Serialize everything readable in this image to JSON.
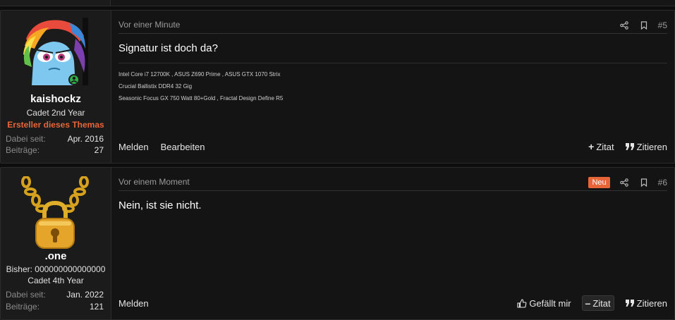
{
  "posts": [
    {
      "user": {
        "name": "kaishockz",
        "title": "Cadet 2nd Year",
        "banner": "Ersteller dieses Themas",
        "stats": [
          {
            "label": "Dabei seit:",
            "value": "Apr. 2016"
          },
          {
            "label": "Beiträge:",
            "value": "27"
          }
        ]
      },
      "date": "Vor einer Minute",
      "number": "#5",
      "body": "Signatur ist doch da?",
      "signature": [
        "Intel Core i7 12700K , ASUS Z690 Prime , ASUS GTX 1070 Strix",
        "Crucial Ballistix DDR4 32 Gig",
        "Seasonic Focus GX 750 Watt 80+Gold , Fractal Design Define R5"
      ],
      "actions_left": [
        "Melden",
        "Bearbeiten"
      ],
      "actions_right": {
        "quote": "Zitat",
        "cite": "Zitieren"
      }
    },
    {
      "user": {
        "name": ".one",
        "extra": "Bisher: 000000000000000",
        "title": "Cadet 4th Year",
        "stats": [
          {
            "label": "Dabei seit:",
            "value": "Jan. 2022"
          },
          {
            "label": "Beiträge:",
            "value": "121"
          }
        ]
      },
      "date": "Vor einem Moment",
      "badge": "Neu",
      "number": "#6",
      "body": "Nein, ist sie nicht.",
      "actions_left": [
        "Melden"
      ],
      "actions_right": {
        "like": "Gefällt mir",
        "quote": "Zitat",
        "cite": "Zitieren"
      }
    }
  ],
  "colors": {
    "accent": "#e8653a",
    "background": "#0d0d0d",
    "panel": "#141414",
    "sidebar": "#1b1b1b"
  },
  "icons": [
    "share-icon",
    "bookmark-icon",
    "thumbs-up-icon",
    "quote-icon",
    "plus-icon",
    "minus-icon",
    "online-indicator-icon",
    "avatar-rainbow-pony",
    "avatar-gold-padlock"
  ]
}
